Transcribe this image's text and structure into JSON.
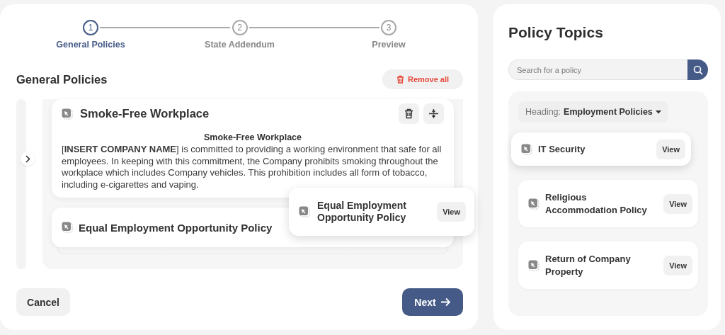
{
  "stepper": [
    {
      "number": "1",
      "label": "General Policies",
      "selected": true
    },
    {
      "number": "2",
      "label": "State Addendum",
      "selected": false
    },
    {
      "number": "3",
      "label": "Preview",
      "selected": false
    }
  ],
  "section": {
    "title": "General Policies",
    "remove_all": "Remove all"
  },
  "policies": [
    {
      "title": "Smoke-Free Workplace",
      "expanded": true,
      "body_heading": "Smoke-Free Workplace",
      "body": "[**INSERT COMPANY NAME**] is committed to providing a working environment that safe for all employees. In keeping with this commitment, the Company prohibits smoking throughout the workplace which includes Company vehicles. This prohibition includes all form of tobacco, including e-cigarettes and vaping."
    },
    {
      "title": "Equal Employment Opportunity Policy",
      "expanded": false
    }
  ],
  "drag_preview": {
    "title": "Equal Employment Opportunity Policy",
    "button": "View"
  },
  "footer": {
    "cancel": "Cancel",
    "next": "Next"
  },
  "topics": {
    "title": "Policy Topics",
    "search": {
      "placeholder": "Search for a policy"
    },
    "heading_label": "Heading:",
    "heading_value": "Employment Policies",
    "items": [
      {
        "title": "IT Security",
        "button": "View",
        "dragging": true
      },
      {
        "title": "Religious Accommodation Policy",
        "button": "View",
        "dragging": false
      },
      {
        "title": "Return of Company Property",
        "button": "View",
        "dragging": false
      }
    ]
  }
}
